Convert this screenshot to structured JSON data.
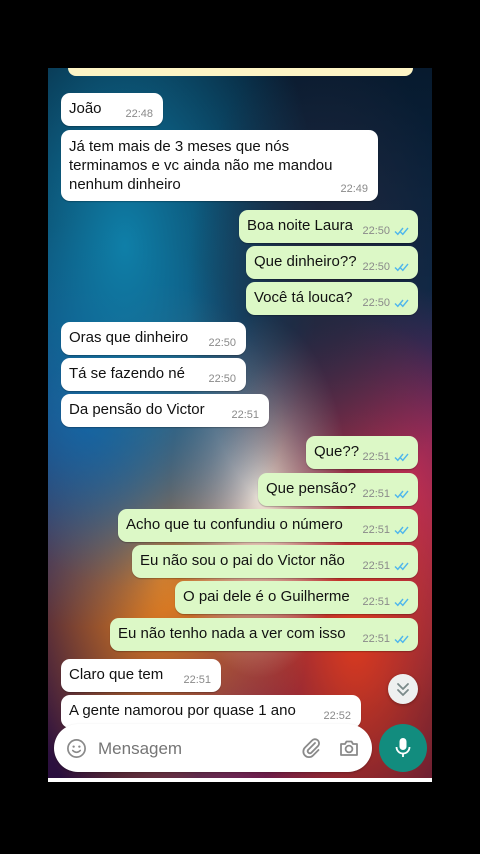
{
  "chat": {
    "messages": [
      {
        "text": "João",
        "time": "22:48",
        "dir": "in"
      },
      {
        "text": "Já tem mais de 3 meses  que nós\nterminamos e vc ainda não me mandou\nnenhum dinheiro",
        "time": "22:49",
        "dir": "in"
      },
      {
        "text": "Boa noite Laura",
        "time": "22:50",
        "dir": "out",
        "status": "read"
      },
      {
        "text": "Que dinheiro??",
        "time": "22:50",
        "dir": "out",
        "status": "read"
      },
      {
        "text": "Você tá louca?",
        "time": "22:50",
        "dir": "out",
        "status": "read"
      },
      {
        "text": "Oras que dinheiro",
        "time": "22:50",
        "dir": "in"
      },
      {
        "text": "Tá se fazendo né",
        "time": "22:50",
        "dir": "in"
      },
      {
        "text": "Da pensão do Victor",
        "time": "22:51",
        "dir": "in"
      },
      {
        "text": "Que??",
        "time": "22:51",
        "dir": "out",
        "status": "read"
      },
      {
        "text": "Que pensão?",
        "time": "22:51",
        "dir": "out",
        "status": "read"
      },
      {
        "text": "Acho que tu confundiu o número",
        "time": "22:51",
        "dir": "out",
        "status": "read"
      },
      {
        "text": "Eu não sou o pai do Victor não",
        "time": "22:51",
        "dir": "out",
        "status": "read"
      },
      {
        "text": "O pai dele é o Guilherme",
        "time": "22:51",
        "dir": "out",
        "status": "read"
      },
      {
        "text": "Eu não tenho nada a ver com isso",
        "time": "22:51",
        "dir": "out",
        "status": "read"
      },
      {
        "text": "Claro que tem",
        "time": "22:51",
        "dir": "in"
      },
      {
        "text": "A gente namorou por quase 1 ano",
        "time": "22:52",
        "dir": "in"
      }
    ]
  },
  "composer": {
    "placeholder": "Mensagem",
    "emoji_icon": "emoji-icon",
    "attach_icon": "paperclip-icon",
    "camera_icon": "camera-icon",
    "mic_icon": "microphone-icon"
  },
  "scroll_button": {
    "icon": "chevrons-down-icon"
  },
  "colors": {
    "incoming_bubble": "#ffffff",
    "outgoing_bubble": "#dcf8c6",
    "read_ticks": "#4fb6ec",
    "mic_button": "#128c7e"
  }
}
